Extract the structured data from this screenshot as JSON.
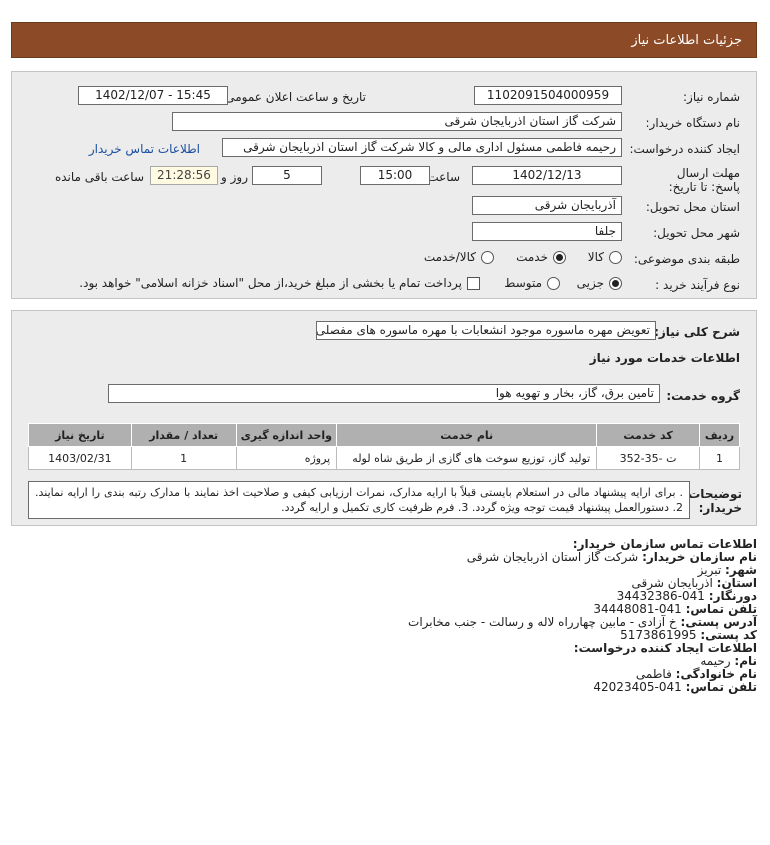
{
  "page_title": "جزئیات اطلاعات نیاز",
  "need_number": {
    "label": "شماره نیاز:",
    "value": "1102091504000959"
  },
  "announce": {
    "label": "تاریخ و ساعت اعلان عمومی:",
    "value": "1402/12/07 - 15:45"
  },
  "buyer": {
    "label": "نام دستگاه خریدار:",
    "value": "شرکت گاز استان اذربایجان شرقی"
  },
  "creator": {
    "label": "ایجاد کننده درخواست:",
    "value": "رحیمه فاطمی مسئول اداری مالی و کالا شرکت گاز استان اذربایجان شرقی",
    "contact_link": "اطلاعات تماس خریدار"
  },
  "deadline": {
    "label": "مهلت ارسال پاسخ: تا تاریخ:",
    "date": "1402/12/13",
    "time_label": "ساعت",
    "time": "15:00",
    "days": "5",
    "days_label": "روز و",
    "remaining": "21:28:56",
    "remaining_label": "ساعت باقی مانده"
  },
  "province": {
    "label": "استان محل تحویل:",
    "value": "آذربایجان شرقی"
  },
  "city": {
    "label": "شهر محل تحویل:",
    "value": "جلفا"
  },
  "category": {
    "label": "طبقه بندی موضوعی:",
    "options": [
      {
        "label": "کالا",
        "checked": false
      },
      {
        "label": "خدمت",
        "checked": true
      },
      {
        "label": "کالا/خدمت",
        "checked": false
      }
    ]
  },
  "process": {
    "label": "نوع فرآیند خرید :",
    "options": [
      {
        "label": "جزیی",
        "checked": true
      },
      {
        "label": "متوسط",
        "checked": false
      }
    ],
    "payment_text": "پرداخت تمام یا بخشی از مبلغ خرید،از محل \"اسناد خزانه اسلامی\" خواهد بود."
  },
  "description": {
    "label": "شرح کلی نیاز:",
    "value": "تعویض مهره ماسوره موجود انشعابات با مهره ماسوره های مفصلی"
  },
  "services_heading": "اطلاعات خدمات مورد نیاز",
  "service_group": {
    "label": "گروه خدمت:",
    "value": "تامین برق، گاز، بخار و تهویه هوا"
  },
  "table": {
    "headers": [
      "ردیف",
      "کد خدمت",
      "نام خدمت",
      "واحد اندازه گیری",
      "تعداد / مقدار",
      "تاریخ نیاز"
    ],
    "rows": [
      [
        "1",
        "ت -35-352",
        "تولید گاز، توزیع سوخت های گازی از طریق شاه لوله",
        "پروژه",
        "1",
        "1403/02/31"
      ]
    ]
  },
  "notes": {
    "label": "توضیحات خریدار:",
    "value": ". برای ارایه پیشنهاد مالی در استعلام بایستی قبلاً با ارایه مدارک، نمرات ارزیابی کیفی و صلاحیت اخذ نمایند با مدارک رتبه بندی را ارایه نمایند. 2. دستورالعمل پیشنهاد قیمت توجه ویژه گردد. 3. فرم ظرفیت کاری تکمیل و ارایه گردد."
  },
  "buyer_contact": {
    "heading": "اطلاعات تماس سازمان خریدار:",
    "org_label": "نام سازمان خریدار:",
    "org": "شرکت گاز استان اذربایجان شرقی",
    "city_label": "شهر:",
    "city": "تبریز",
    "province_label": "استان:",
    "province": "اذربایجان شرقی",
    "fax_label": "دورنگار:",
    "fax": "041-34432386",
    "phone_label": "تلفن تماس:",
    "phone": "041-34448081",
    "address_label": "آدرس پستی:",
    "address": "خ آزادی - مابین چهارراه لاله و رسالت - جنب مخابرات",
    "postal_label": "کد پستی:",
    "postal": "5173861995"
  },
  "creator_contact": {
    "heading": "اطلاعات ایجاد کننده درخواست:",
    "name_label": "نام:",
    "name": "رحیمه",
    "family_label": "نام خانوادگی:",
    "family": "فاطمی",
    "phone_label": "تلفن تماس:",
    "phone": "041-42023405"
  },
  "colors": {
    "titlebar": "#8c4a26",
    "panel": "#ececec",
    "table_header": "#b0b0b0",
    "link": "#1a4fa0"
  }
}
